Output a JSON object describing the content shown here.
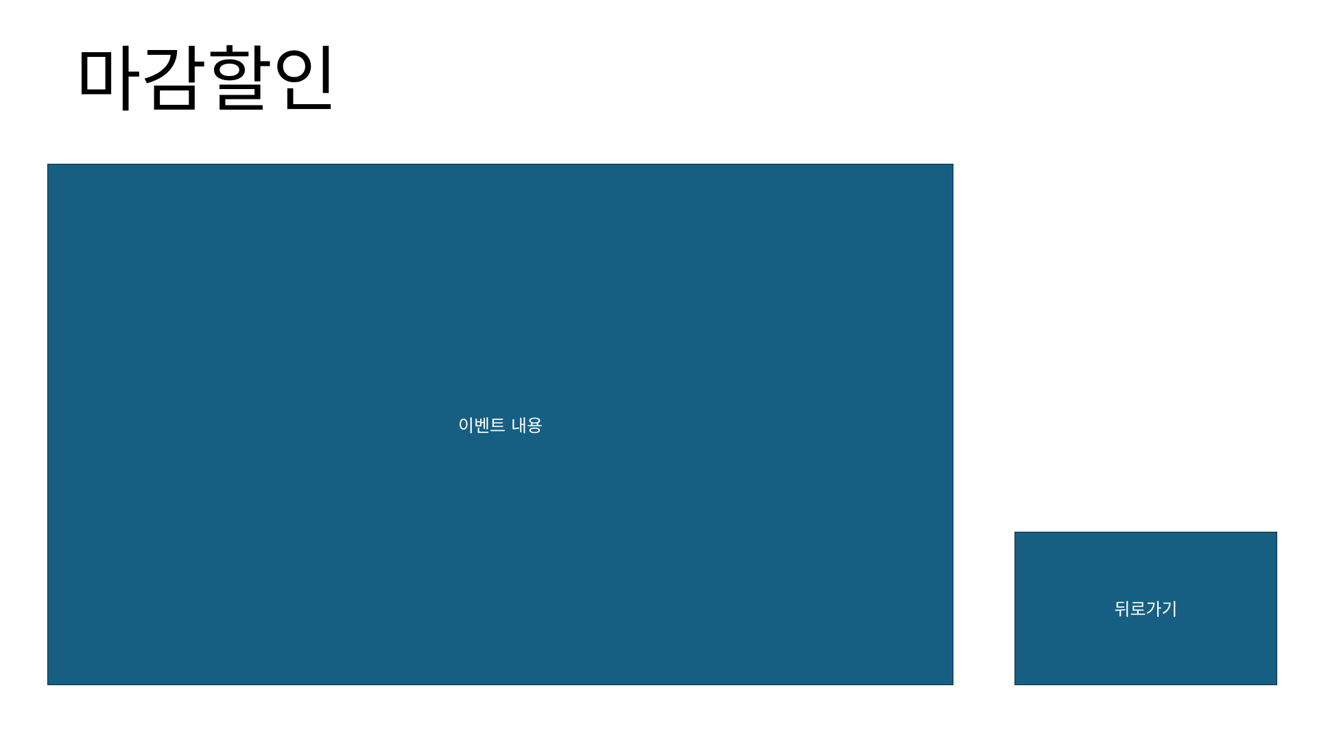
{
  "page": {
    "title": "마감할인"
  },
  "event_panel": {
    "label": "이벤트 내용"
  },
  "back_button": {
    "label": "뒤로가기"
  },
  "colors": {
    "panel_fill": "#175f82",
    "panel_border": "#0d2a3d",
    "text_on_panel": "#ffffff",
    "title_text": "#000000",
    "background": "#ffffff"
  }
}
